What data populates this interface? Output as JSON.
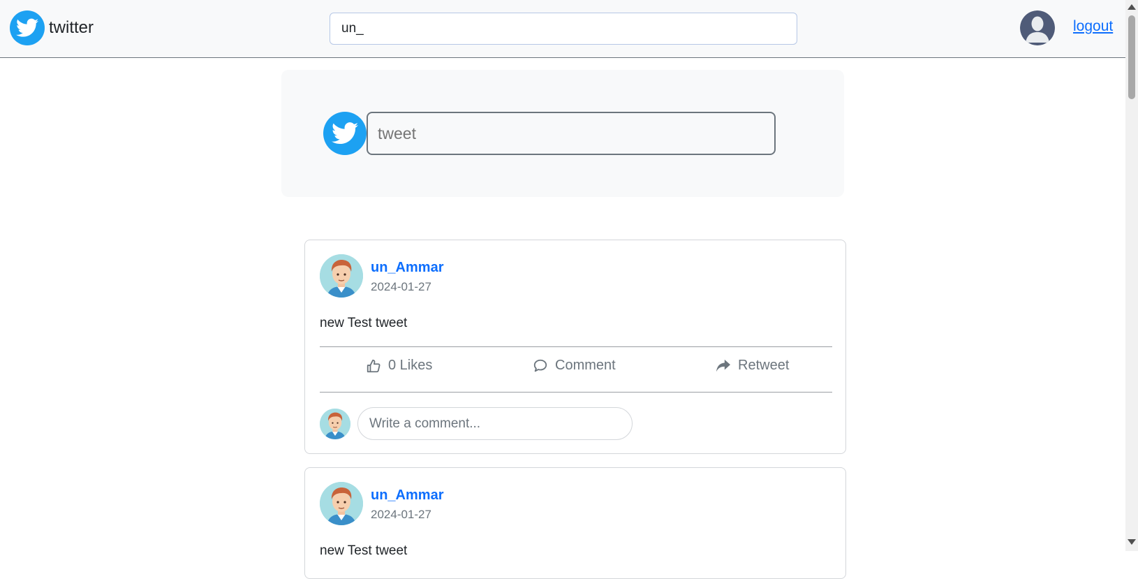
{
  "navbar": {
    "brand_text": "twitter",
    "search_value": "un_",
    "logout_label": "logout"
  },
  "compose": {
    "placeholder": "tweet"
  },
  "tweets": [
    {
      "author": "un_Ammar",
      "date": "2024-01-27",
      "text": "new Test tweet",
      "likes_label": "0 Likes",
      "comment_label": "Comment",
      "retweet_label": "Retweet",
      "comment_placeholder": "Write a comment..."
    },
    {
      "author": "un_Ammar",
      "date": "2024-01-27",
      "text": "new Test tweet"
    }
  ],
  "colors": {
    "brand": "#1da1f2",
    "link": "#0d6efd",
    "muted": "#6c757d"
  },
  "icons": [
    "twitter-bird-icon",
    "user-avatar-icon",
    "thumbs-up-icon",
    "comment-bubble-icon",
    "retweet-share-icon"
  ]
}
